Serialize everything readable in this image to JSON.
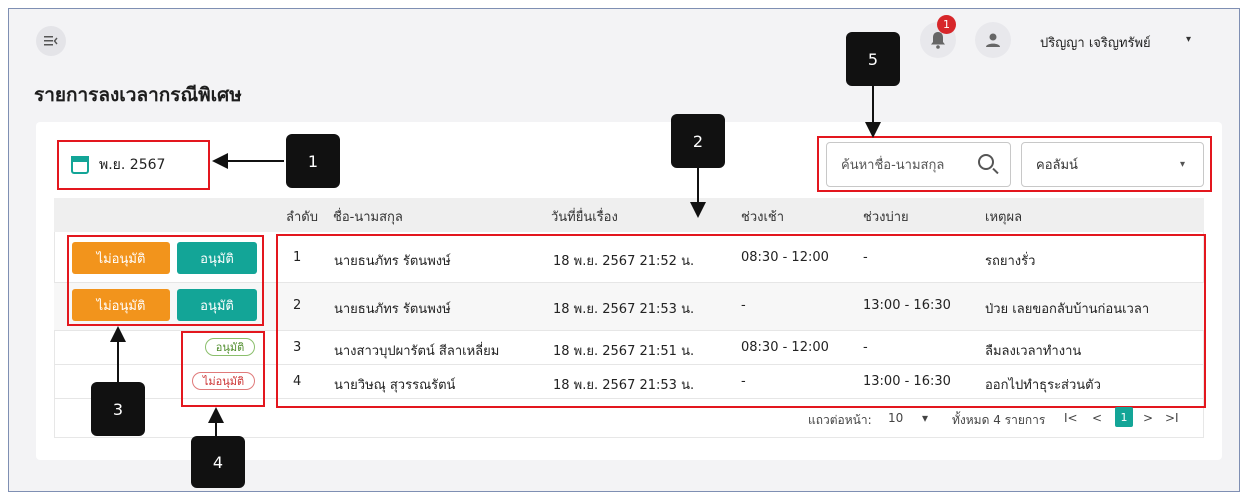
{
  "header": {
    "menu_icon": "menu-collapse-icon",
    "notification_count": "1",
    "user_name": "ปริญญา เจริญทรัพย์",
    "caret": "▾"
  },
  "page": {
    "title": "รายการลงเวลากรณีพิเศษ"
  },
  "filters": {
    "month_value": "พ.ย. 2567",
    "search_placeholder": "ค้นหาชื่อ-นามสกุล",
    "column_select_value": "คอลัมน์"
  },
  "table": {
    "headers": [
      "ลำดับ",
      "ชื่อ-นามสกุล",
      "วันที่ยื่นเรื่อง",
      "ช่วงเช้า",
      "ช่วงบ่าย",
      "เหตุผล"
    ],
    "rows": [
      {
        "no": "1",
        "name": "นายธนภัทร รัตนพงษ์",
        "date": "18 พ.ย. 2567 21:52 น.",
        "morning": "08:30 - 12:00",
        "afternoon": "-",
        "reason": "รถยางรั่ว"
      },
      {
        "no": "2",
        "name": "นายธนภัทร รัตนพงษ์",
        "date": "18 พ.ย. 2567 21:53 น.",
        "morning": "-",
        "afternoon": "13:00 - 16:30",
        "reason": "ป่วย เลยขอกลับบ้านก่อนเวลา"
      },
      {
        "no": "3",
        "name": "นางสาวบุปผารัตน์ สีลาเหลี่ยม",
        "date": "18 พ.ย. 2567 21:51 น.",
        "morning": "08:30 - 12:00",
        "afternoon": "-",
        "reason": "ลืมลงเวลาทำงาน"
      },
      {
        "no": "4",
        "name": "นายวิษณุ สุวรรณรัตน์",
        "date": "18 พ.ย. 2567 21:53 น.",
        "morning": "-",
        "afternoon": "13:00 - 16:30",
        "reason": "ออกไปทำธุระส่วนตัว"
      }
    ],
    "actions": {
      "reject_label": "ไม่อนุมัติ",
      "approve_label": "อนุมัติ",
      "status_approved": "อนุมัติ",
      "status_rejected": "ไม่อนุมัติ"
    }
  },
  "pagination": {
    "rows_per_page_label": "แถวต่อหน้า:",
    "rows_per_page_value": "10",
    "total_label": "ทั้งหมด 4 รายการ",
    "first": "I<",
    "prev": "<",
    "current_page": "1",
    "next": ">",
    "last": ">I"
  },
  "annotations": [
    "1",
    "2",
    "3",
    "4",
    "5"
  ],
  "colors": {
    "accent": "#13a597",
    "reject": "#f2941c",
    "highlight": "#e3171e",
    "badge": "#d7262a"
  }
}
